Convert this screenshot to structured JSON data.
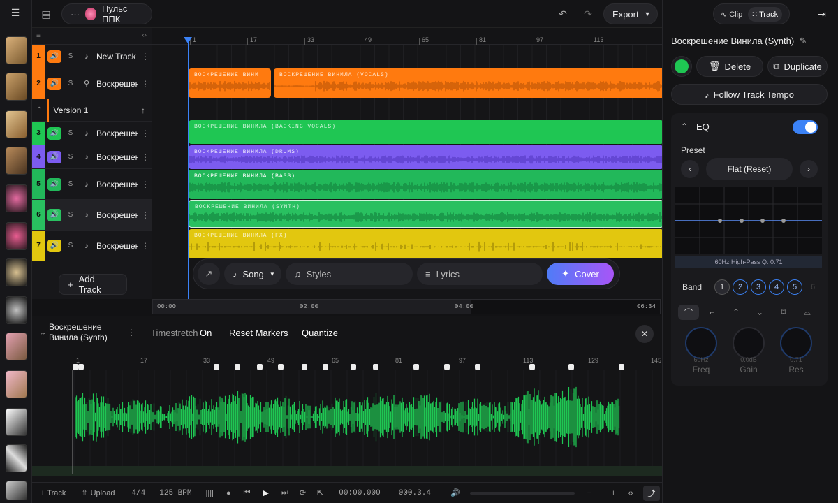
{
  "project": {
    "name": "Пульс ППК"
  },
  "top": {
    "export_label": "Export",
    "clip_tab": "Clip",
    "track_tab": "Track"
  },
  "tracks": [
    {
      "num": "1",
      "name": "New Track",
      "color": "#ff7a0f"
    },
    {
      "num": "2",
      "name": "Воскрешение Винила",
      "color": "#ff7a0f"
    },
    {
      "num": "3",
      "name": "Воскрешение Винила",
      "color": "#1fc653"
    },
    {
      "num": "4",
      "name": "Воскрешение Винила",
      "color": "#7c5cf0"
    },
    {
      "num": "5",
      "name": "Воскрешение Винила",
      "color": "#22b85a"
    },
    {
      "num": "6",
      "name": "Воскрешение Винила",
      "color": "#29c060"
    },
    {
      "num": "7",
      "name": "Воскрешение Винила",
      "color": "#e2c70f"
    }
  ],
  "solo_label": "S",
  "version_label": "Version 1",
  "add_track_label": "Add Track",
  "ruler_ticks": [
    "1",
    "17",
    "33",
    "49",
    "65",
    "81",
    "97",
    "113"
  ],
  "clips": [
    {
      "label": "ВОСКРЕШЕНИЕ ВИНИ"
    },
    {
      "label": "ВОСКРЕШЕНИЕ ВИНИЛА (VOCALS)"
    },
    {
      "label": "ВОСКРЕШЕНИЕ ВИНИЛА (BACKING VOCALS)"
    },
    {
      "label": "ВОСКРЕШЕНИЕ ВИНИЛА (DRUMS)"
    },
    {
      "label": "ВОСКРЕШЕНИЕ ВИНИЛА (BASS)"
    },
    {
      "label": "ВОСКРЕШЕНИЕ ВИНИЛА (SYNTH)"
    },
    {
      "label": "ВОСКРЕШЕНИЕ ВИНИЛА (FX)"
    }
  ],
  "gen_bar": {
    "song": "Song",
    "styles": "Styles",
    "lyrics": "Lyrics",
    "cover": "Cover"
  },
  "mini_time": [
    "00:00",
    "02:00",
    "04:00",
    "06:34"
  ],
  "editor": {
    "title": "Воскрешение Винила (Synth)",
    "timestretch": "Timestretch",
    "timestretch_val": "On",
    "reset_markers": "Reset Markers",
    "quantize": "Quantize",
    "ticks": [
      "1",
      "17",
      "33",
      "49",
      "65",
      "81",
      "97",
      "113",
      "129",
      "145"
    ]
  },
  "footer": {
    "track": "+ Track",
    "upload": "Upload",
    "sig": "4/4",
    "bpm": "125 BPM",
    "time": "00:00.000",
    "pos": "000.3.4"
  },
  "panel": {
    "title": "Воскрешение Винила (Synth)",
    "delete": "Delete",
    "duplicate": "Duplicate",
    "follow": "Follow Track Tempo",
    "eq": "EQ",
    "preset": "Preset",
    "preset_val": "Flat (Reset)",
    "eq_info": "60Hz  High-Pass  Q: 0.71",
    "band": "Band",
    "bands": [
      "1",
      "2",
      "3",
      "4",
      "5",
      "6"
    ],
    "knobs": [
      {
        "val": "60Hz",
        "label": "Freq"
      },
      {
        "val": "0.0dB",
        "label": "Gain"
      },
      {
        "val": "0.71",
        "label": "Res"
      }
    ]
  },
  "colors": {
    "orange": "#ff7a0f",
    "green": "#1fc653",
    "purple": "#7c5cf0",
    "yellow": "#e2c70f",
    "accent": "#3b82f6"
  }
}
